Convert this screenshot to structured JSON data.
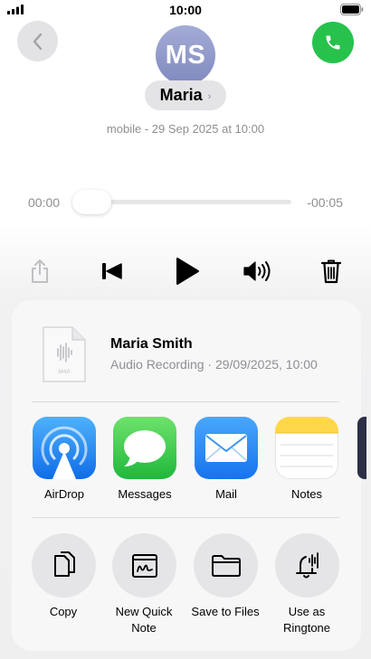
{
  "status_bar": {
    "time": "10:00"
  },
  "header": {
    "avatar_initials": "MS",
    "contact_name": "Maria",
    "name_chevron": "›",
    "subtitle": "mobile - 29 Sep 2025 at 10:00"
  },
  "player": {
    "elapsed": "00:00",
    "remaining": "-00:05",
    "progress": 0.0
  },
  "share_sheet": {
    "file": {
      "title": "Maria Smith",
      "meta": "Audio Recording · 29/09/2025, 10:00",
      "type_label": "M4A"
    },
    "apps": [
      {
        "label": "AirDrop",
        "icon": "airdrop-icon"
      },
      {
        "label": "Messages",
        "icon": "messages-icon"
      },
      {
        "label": "Mail",
        "icon": "mail-icon"
      },
      {
        "label": "Notes",
        "icon": "notes-icon"
      }
    ],
    "actions": [
      {
        "label": "Copy",
        "icon": "copy-icon"
      },
      {
        "label": "New Quick\nNote",
        "icon": "quick-note-icon"
      },
      {
        "label": "Save to Files",
        "icon": "folder-icon"
      },
      {
        "label": "Use as\nRingtone",
        "icon": "ringtone-icon"
      }
    ]
  },
  "colors": {
    "call_green": "#27c24c",
    "airdrop_blue": "#1a8cf5",
    "messages_green": "#34c759",
    "mail_blue": "#2a8ff7",
    "notes_yellow": "#ffd84a"
  }
}
